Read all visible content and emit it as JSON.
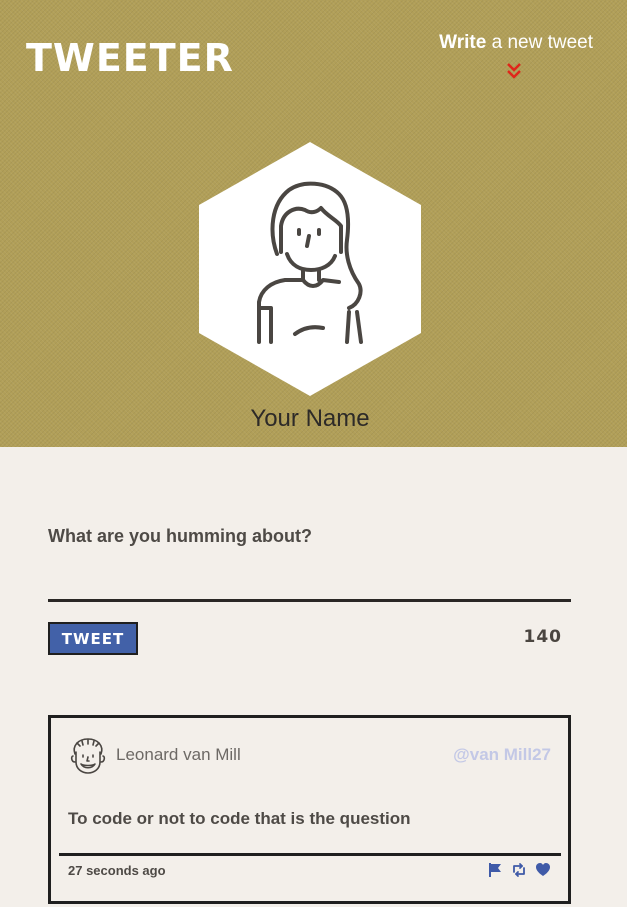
{
  "header": {
    "brand": "TWEETER",
    "write_bold": "Write",
    "write_rest": " a new tweet",
    "user_name": "Your Name"
  },
  "compose": {
    "prompt": "What are you humming about?",
    "input_value": "",
    "button_label": "TWEET",
    "counter": "140"
  },
  "tweets": [
    {
      "author": "Leonard van Mill",
      "handle": "@van Mill27",
      "text": "To code or not to code that is the question",
      "time": "27 seconds ago"
    }
  ],
  "colors": {
    "header_bg": "#b19f58",
    "page_bg": "#f3efea",
    "button_bg": "#4261a8",
    "action_icons": "#3f5aa8",
    "chevron": "#e0251a",
    "handle": "#c3c8e6"
  },
  "icons": [
    "double-chevron-down-icon",
    "woman-avatar-icon",
    "man-avatar-icon",
    "flag-icon",
    "retweet-icon",
    "heart-icon"
  ]
}
